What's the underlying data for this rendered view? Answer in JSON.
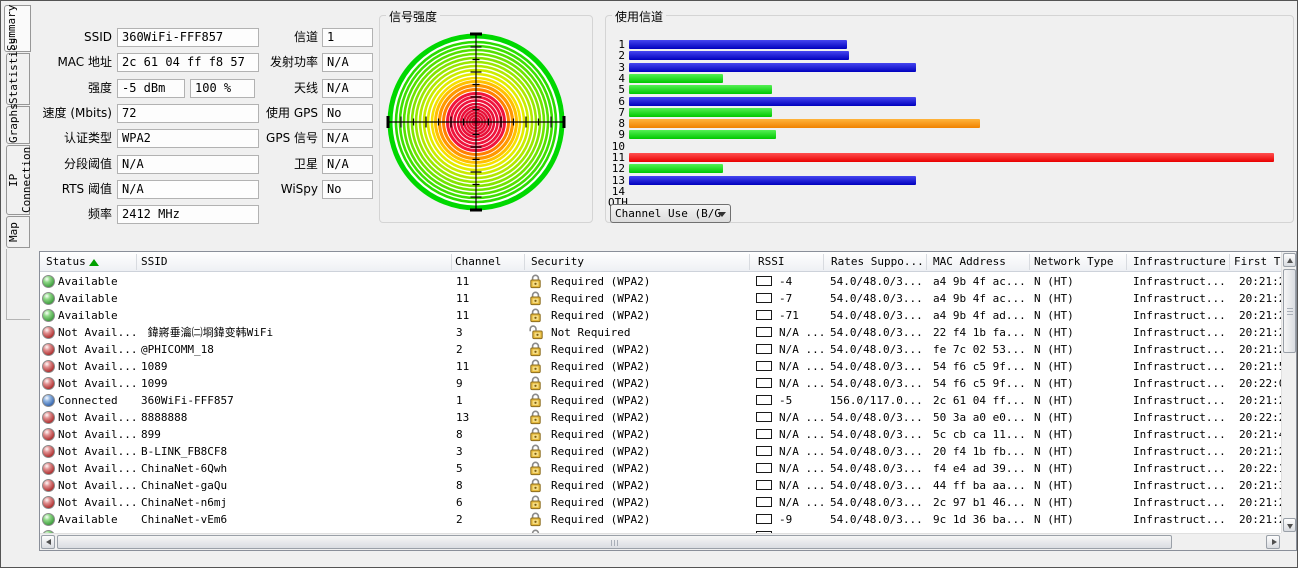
{
  "tabs": [
    {
      "label": "Summary",
      "selected": true
    },
    {
      "label": "Statistics",
      "selected": false
    },
    {
      "label": "Graphs",
      "selected": false
    },
    {
      "label": "IP Connection",
      "selected": false
    },
    {
      "label": "Map",
      "selected": false
    }
  ],
  "summary_form": {
    "left": [
      {
        "label": "SSID",
        "value": "360WiFi-FFF857"
      },
      {
        "label": "MAC 地址",
        "value": "2c 61 04 ff f8 57"
      },
      {
        "label": "强度",
        "value": "-5 dBm",
        "value2": "100 %"
      },
      {
        "label": "速度 (Mbits)",
        "value": "72"
      },
      {
        "label": "认证类型",
        "value": "WPA2"
      },
      {
        "label": "分段阈值",
        "value": "N/A"
      },
      {
        "label": "RTS 阈值",
        "value": "N/A"
      },
      {
        "label": "频率",
        "value": "2412 MHz"
      }
    ],
    "right": [
      {
        "label": "信道",
        "value": "1"
      },
      {
        "label": "发射功率",
        "value": "N/A"
      },
      {
        "label": "天线",
        "value": "N/A"
      },
      {
        "label": "使用 GPS",
        "value": "No"
      },
      {
        "label": "GPS 信号",
        "value": "N/A"
      },
      {
        "label": "卫星",
        "value": "N/A"
      },
      {
        "label": "WiSpy",
        "value": "No"
      }
    ]
  },
  "chart_data": [
    {
      "type": "area",
      "subtype": "concentric-signal-gauge",
      "title": "信号强度",
      "description": "Polar signal-strength gauge: strong signal (red/crimson) at center through orange and yellow to weak (green) at outer edge; black crosshair axes with ticks",
      "rings": [
        [
          86,
          "#00d800",
          5
        ],
        [
          80,
          "#2bdc00",
          2.6
        ],
        [
          76,
          "#3fe000",
          2.6
        ],
        [
          72,
          "#55e000",
          2.6
        ],
        [
          68,
          "#6fe400",
          2.6
        ],
        [
          64,
          "#84e400",
          2.6
        ],
        [
          60,
          "#9ae800",
          2.6
        ],
        [
          56,
          "#b2e800",
          2.6
        ],
        [
          52,
          "#caec00",
          2.6
        ],
        [
          48,
          "#e2ec00",
          2.6
        ],
        [
          44,
          "#f6e000",
          2.6
        ],
        [
          40.5,
          "#ffc000",
          3
        ],
        [
          36.5,
          "#ff9800",
          3.2
        ],
        [
          32.5,
          "#ff8000",
          3
        ],
        [
          28.5,
          "#f0143c",
          3
        ],
        [
          25,
          "#ee143c",
          2.8
        ],
        [
          21.5,
          "#ee143c",
          2.6
        ],
        [
          18,
          "#ea1038",
          2.6
        ],
        [
          14.8,
          "#ea1038",
          2.6
        ],
        [
          11.8,
          "#e61038",
          2.4
        ],
        [
          9,
          "#e61034",
          2.4
        ],
        [
          6.4,
          "#e21034",
          2.2
        ],
        [
          4,
          "#e21034",
          2
        ],
        [
          1.8,
          "#e00030",
          2.4
        ]
      ]
    },
    {
      "type": "bar",
      "title": "使用信道",
      "orientation": "horizontal",
      "note": "pct = bar length as percent of chart width (relative channel usage)",
      "dropdown": "Channel Use (B/G",
      "palette": {
        "blue": [
          "#4646f0",
          "#0000be"
        ],
        "green": [
          "#55f055",
          "#00c800"
        ],
        "orange": [
          "#ffb43c",
          "#f08200"
        ],
        "red": [
          "#ff5050",
          "#e80000"
        ]
      },
      "bars": [
        {
          "ch": "1",
          "pct": 33.1,
          "color": "blue"
        },
        {
          "ch": "2",
          "pct": 33.4,
          "color": "blue"
        },
        {
          "ch": "3",
          "pct": 43.6,
          "color": "blue"
        },
        {
          "ch": "4",
          "pct": 14.3,
          "color": "green"
        },
        {
          "ch": "5",
          "pct": 21.8,
          "color": "green"
        },
        {
          "ch": "6",
          "pct": 43.6,
          "color": "blue"
        },
        {
          "ch": "7",
          "pct": 21.8,
          "color": "green"
        },
        {
          "ch": "8",
          "pct": 53.4,
          "color": "orange"
        },
        {
          "ch": "9",
          "pct": 22.3,
          "color": "green"
        },
        {
          "ch": "10",
          "pct": 0,
          "color": "green"
        },
        {
          "ch": "11",
          "pct": 98,
          "color": "red"
        },
        {
          "ch": "12",
          "pct": 14.3,
          "color": "green"
        },
        {
          "ch": "13",
          "pct": 43.6,
          "color": "blue"
        },
        {
          "ch": "14",
          "pct": 0,
          "color": "green"
        },
        {
          "ch": "OTH",
          "pct": 0,
          "color": "green"
        }
      ]
    }
  ],
  "table": {
    "columns": [
      "Status",
      "SSID",
      "Channel",
      "Security",
      "RSSI",
      "Rates Suppo...",
      "MAC Address",
      "Network Type",
      "Infrastructure",
      "First T"
    ],
    "sort_column": "Status",
    "rows": [
      {
        "status": "Available",
        "status_color": "green",
        "ssid": "",
        "channel": "11",
        "locked": true,
        "security": "Required (WPA2)",
        "rssi_fill": 1,
        "rssi": "-4",
        "rates": "54.0/48.0/3...",
        "mac": "a4 9b 4f ac...",
        "network": "N (HT)",
        "infra": "Infrastruct...",
        "first": "20:21:2"
      },
      {
        "status": "Available",
        "status_color": "green",
        "ssid": "",
        "channel": "11",
        "locked": true,
        "security": "Required (WPA2)",
        "rssi_fill": 1,
        "rssi": "-7",
        "rates": "54.0/48.0/3...",
        "mac": "a4 9b 4f ac...",
        "network": "N (HT)",
        "infra": "Infrastruct...",
        "first": "20:21:2"
      },
      {
        "status": "Available",
        "status_color": "green",
        "ssid": "",
        "channel": "11",
        "locked": true,
        "security": "Required (WPA2)",
        "rssi_fill": 0.2,
        "rssi": "-71",
        "rates": "54.0/48.0/3...",
        "mac": "a4 9b 4f ad...",
        "network": "N (HT)",
        "infra": "Infrastruct...",
        "first": "20:21:2"
      },
      {
        "status": "Not Avail...",
        "status_color": "red",
        "ssid": " 鍏嶈垂瀹㈡埛鍏变韩WiFi",
        "channel": "3",
        "locked": false,
        "security": "Not Required",
        "rssi_fill": 0.15,
        "rssi": "N/A ...",
        "rates": "54.0/48.0/3...",
        "mac": "22 f4 1b fa...",
        "network": "N (HT)",
        "infra": "Infrastruct...",
        "first": "20:21:2"
      },
      {
        "status": "Not Avail...",
        "status_color": "red",
        "ssid": "@PHICOMM_18",
        "channel": "2",
        "locked": true,
        "security": "Required (WPA2)",
        "rssi_fill": 0,
        "rssi": "N/A ...",
        "rates": "54.0/48.0/3...",
        "mac": "fe 7c 02 53...",
        "network": "N (HT)",
        "infra": "Infrastruct...",
        "first": "20:21:2"
      },
      {
        "status": "Not Avail...",
        "status_color": "red",
        "ssid": "1089",
        "channel": "11",
        "locked": true,
        "security": "Required (WPA2)",
        "rssi_fill": 0,
        "rssi": "N/A ...",
        "rates": "54.0/48.0/3...",
        "mac": "54 f6 c5 9f...",
        "network": "N (HT)",
        "infra": "Infrastruct...",
        "first": "20:21:5"
      },
      {
        "status": "Not Avail...",
        "status_color": "red",
        "ssid": "1099",
        "channel": "9",
        "locked": true,
        "security": "Required (WPA2)",
        "rssi_fill": 0,
        "rssi": "N/A ...",
        "rates": "54.0/48.0/3...",
        "mac": "54 f6 c5 9f...",
        "network": "N (HT)",
        "infra": "Infrastruct...",
        "first": "20:22:0"
      },
      {
        "status": "Connected",
        "status_color": "blue",
        "ssid": "360WiFi-FFF857",
        "channel": "1",
        "locked": true,
        "security": "Required (WPA2)",
        "rssi_fill": 1,
        "rssi": "-5",
        "rates": "156.0/117.0...",
        "mac": "2c 61 04 ff...",
        "network": "N (HT)",
        "infra": "Infrastruct...",
        "first": "20:21:2"
      },
      {
        "status": "Not Avail...",
        "status_color": "red",
        "ssid": "8888888",
        "channel": "13",
        "locked": true,
        "security": "Required (WPA2)",
        "rssi_fill": 0.07,
        "rssi": "N/A ...",
        "rates": "54.0/48.0/3...",
        "mac": "50 3a a0 e0...",
        "network": "N (HT)",
        "infra": "Infrastruct...",
        "first": "20:22:2"
      },
      {
        "status": "Not Avail...",
        "status_color": "red",
        "ssid": "899",
        "channel": "8",
        "locked": true,
        "security": "Required (WPA2)",
        "rssi_fill": 0.07,
        "rssi": "N/A ...",
        "rates": "54.0/48.0/3...",
        "mac": "5c cb ca 11...",
        "network": "N (HT)",
        "infra": "Infrastruct...",
        "first": "20:21:4"
      },
      {
        "status": "Not Avail...",
        "status_color": "red",
        "ssid": "B-LINK_FB8CF8",
        "channel": "3",
        "locked": true,
        "security": "Required (WPA2)",
        "rssi_fill": 0.25,
        "rssi": "N/A ...",
        "rates": "54.0/48.0/3...",
        "mac": "20 f4 1b fb...",
        "network": "N (HT)",
        "infra": "Infrastruct...",
        "first": "20:21:2"
      },
      {
        "status": "Not Avail...",
        "status_color": "red",
        "ssid": "ChinaNet-6Qwh",
        "channel": "5",
        "locked": true,
        "security": "Required (WPA2)",
        "rssi_fill": 0,
        "rssi": "N/A ...",
        "rates": "54.0/48.0/3...",
        "mac": "f4 e4 ad 39...",
        "network": "N (HT)",
        "infra": "Infrastruct...",
        "first": "20:22:1"
      },
      {
        "status": "Not Avail...",
        "status_color": "red",
        "ssid": "ChinaNet-gaQu",
        "channel": "8",
        "locked": true,
        "security": "Required (WPA2)",
        "rssi_fill": 0.07,
        "rssi": "N/A ...",
        "rates": "54.0/48.0/3...",
        "mac": "44 ff ba aa...",
        "network": "N (HT)",
        "infra": "Infrastruct...",
        "first": "20:21:3"
      },
      {
        "status": "Not Avail...",
        "status_color": "red",
        "ssid": "ChinaNet-n6mj",
        "channel": "6",
        "locked": true,
        "security": "Required (WPA2)",
        "rssi_fill": 0,
        "rssi": "N/A ...",
        "rates": "54.0/48.0/3...",
        "mac": "2c 97 b1 46...",
        "network": "N (HT)",
        "infra": "Infrastruct...",
        "first": "20:21:2"
      },
      {
        "status": "Available",
        "status_color": "green",
        "ssid": "ChinaNet-vEm6",
        "channel": "2",
        "locked": true,
        "security": "Required (WPA2)",
        "rssi_fill": 1,
        "rssi": "-9",
        "rates": "54.0/48.0/3...",
        "mac": "9c 1d 36 ba...",
        "network": "N (HT)",
        "infra": "Infrastruct...",
        "first": "20:21:2"
      },
      {
        "status": "",
        "status_color": "green",
        "ssid": "",
        "channel": "",
        "locked": true,
        "security": "",
        "rssi_fill": 1,
        "rssi": "",
        "rates": "",
        "mac": "",
        "network": "",
        "infra": "",
        "first": "",
        "partial": true
      }
    ]
  }
}
